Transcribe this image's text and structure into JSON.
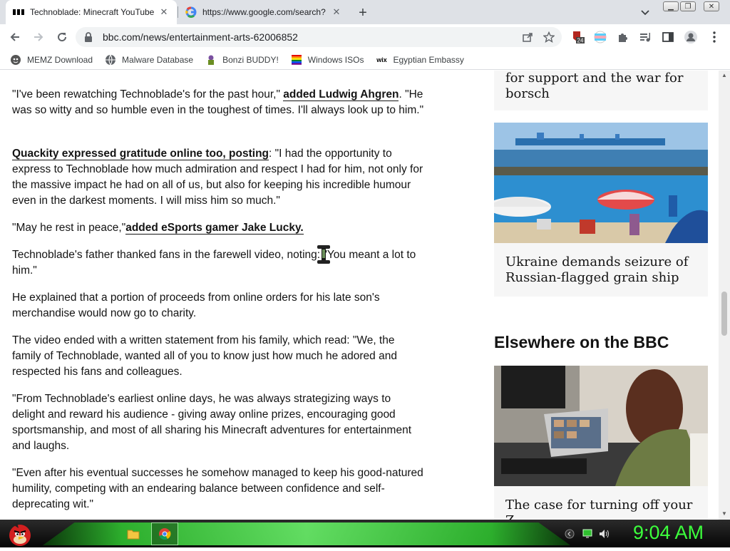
{
  "tabs": [
    {
      "title": "Technoblade: Minecraft YouTube",
      "active": true
    },
    {
      "title": "https://www.google.com/search?",
      "active": false
    }
  ],
  "toolbar": {
    "url": "bbc.com/news/entertainment-arts-62006852",
    "extension_badge": "24"
  },
  "bookmarks": [
    {
      "label": "MEMZ Download",
      "icon": "memz-icon"
    },
    {
      "label": "Malware Database",
      "icon": "globe-icon"
    },
    {
      "label": "Bonzi BUDDY!",
      "icon": "bonzi-icon"
    },
    {
      "label": "Windows ISOs",
      "icon": "windows-flag-icon"
    },
    {
      "label": "Egyptian Embassy",
      "icon": "wix-icon"
    }
  ],
  "article": {
    "p1_text": "\"I've been rewatching Technoblade's for the past hour,\" ",
    "p1_link": "added Ludwig Ahgren",
    "p1_tail": ". \"He was so witty and so humble even in the toughest of times. I'll always look up to him.\"",
    "p2_link": "Quackity expressed gratitude online too, posting",
    "p2_tail": ": \"I had the opportunity to express to Technoblade how much admiration and respect I had for him, not only for the massive impact he had on all of us, but also for keeping his incredible humour even in the darkest moments. I will miss him so much.\"",
    "p3_text": "\"May he rest in peace,\"",
    "p3_link": "added eSports gamer Jake Lucky.",
    "p4": "Technoblade's father thanked fans in the farewell video, noting: \"You meant a lot to him.\"",
    "p5": "He explained that a portion of proceeds from online orders for his late son's merchandise would now go to charity.",
    "p6": "The video ended with a written statement from his family, which read: \"We, the family of Technoblade, wanted all of you to know just how much he adored and respected his fans and colleagues.",
    "p7": "\"From Technoblade's earliest online days, he was always strategizing ways to delight and reward his audience - giving away online prizes, encouraging good sportsmanship, and most of all sharing his Minecraft adventures for entertainment and laughs.",
    "p8": "\"Even after his eventual successes he somehow managed to keep his good-natured humility, competing with an endearing balance between confidence and self-deprecating wit.\""
  },
  "sidebar": {
    "card1_title": "for support and the war for borsch",
    "card2_title": "Ukraine demands seizure of Russian-flagged grain ship",
    "section_title": "Elsewhere on the BBC",
    "card3_title": "The case for turning off your Z"
  },
  "taskbar": {
    "clock": "9:04 AM"
  },
  "colors": {
    "clock": "#3cff3c",
    "taskbar_green": "#2fbf2f"
  }
}
